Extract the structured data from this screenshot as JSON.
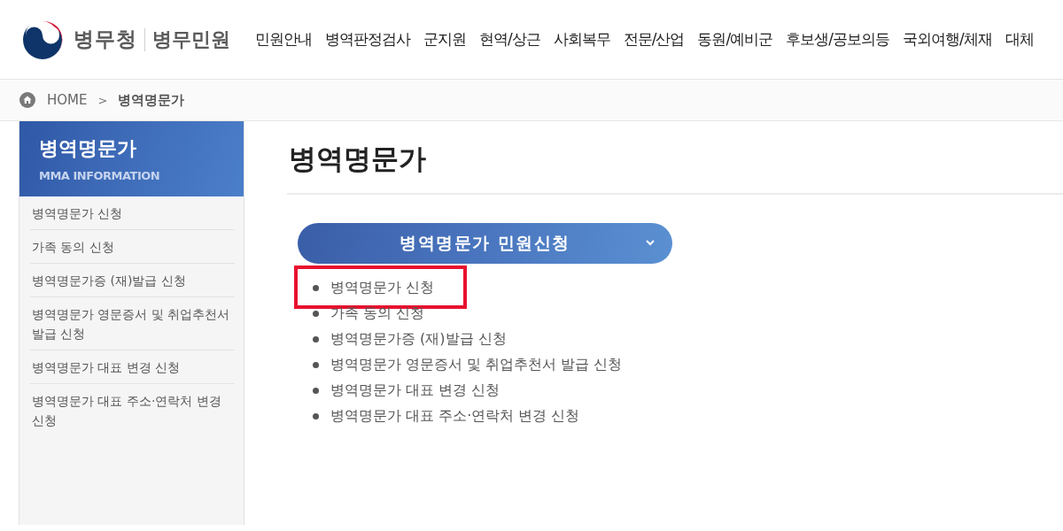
{
  "header": {
    "logo": {
      "org": "병무청",
      "service": "병무민원"
    },
    "nav": [
      "민원안내",
      "병역판정검사",
      "군지원",
      "현역/상근",
      "사회복무",
      "전문/산업",
      "동원/예비군",
      "후보생/공보의등",
      "국외여행/체재",
      "대체"
    ]
  },
  "breadcrumb": {
    "home": "HOME",
    "separator": ">",
    "current": "병역명문가"
  },
  "sidebar": {
    "title": "병역명문가",
    "subtitle": "MMA INFORMATION",
    "items": [
      "병역명문가 신청",
      "가족 동의 신청",
      "병역명문가증 (재)발급 신청",
      "병역명문가 영문증서 및 취업추천서 발급 신청",
      "병역명문가 대표 변경 신청",
      "병역명문가 대표 주소·연락처 변경 신청"
    ]
  },
  "main": {
    "title": "병역명문가",
    "dropdown": {
      "label": "병역명문가 민원신청"
    },
    "links": [
      {
        "label": "병역명문가 신청",
        "highlighted": true
      },
      {
        "label": "가족 동의 신청",
        "highlighted": false
      },
      {
        "label": "병역명문가증 (재)발급 신청",
        "highlighted": false
      },
      {
        "label": "병역명문가 영문증서 및 취업추천서 발급 신청",
        "highlighted": false
      },
      {
        "label": "병역명문가 대표 변경 신청",
        "highlighted": false
      },
      {
        "label": "병역명문가 대표 주소·연락처 변경 신청",
        "highlighted": false
      }
    ]
  }
}
